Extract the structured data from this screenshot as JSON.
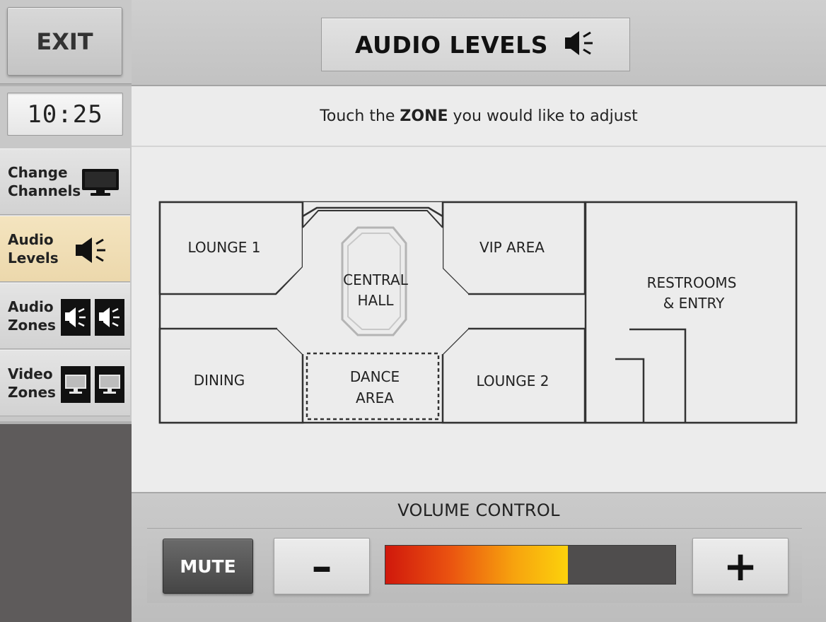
{
  "sidebar": {
    "exit_label": "EXIT",
    "clock": "10:25",
    "items": [
      {
        "label": "Change\nChannels",
        "icon": "tv-icon",
        "active": false
      },
      {
        "label": "Audio\nLevels",
        "icon": "speaker-icon",
        "active": true
      },
      {
        "label": "Audio\nZones",
        "icon": "speaker-zones-icon",
        "active": false
      },
      {
        "label": "Video\nZones",
        "icon": "monitor-zones-icon",
        "active": false
      }
    ]
  },
  "header": {
    "title": "AUDIO LEVELS",
    "icon": "speaker-icon"
  },
  "instruction": {
    "prefix": "Touch the ",
    "emphasis": "ZONE",
    "suffix": " you would like to adjust"
  },
  "zones": {
    "lounge1": "LOUNGE 1",
    "central_hall": [
      "CENTRAL",
      "HALL"
    ],
    "vip_area": "VIP AREA",
    "restrooms": [
      "RESTROOMS",
      "& ENTRY"
    ],
    "dining": "DINING",
    "dance_area": [
      "DANCE",
      "AREA"
    ],
    "lounge2": "LOUNGE 2"
  },
  "volume": {
    "title": "VOLUME CONTROL",
    "mute_label": "MUTE",
    "minus_label": "–",
    "plus_label": "+",
    "level_percent": 63
  },
  "colors": {
    "active_tab": "#ecd8ac",
    "level_start": "#d0180c",
    "level_end": "#fcd20c"
  }
}
